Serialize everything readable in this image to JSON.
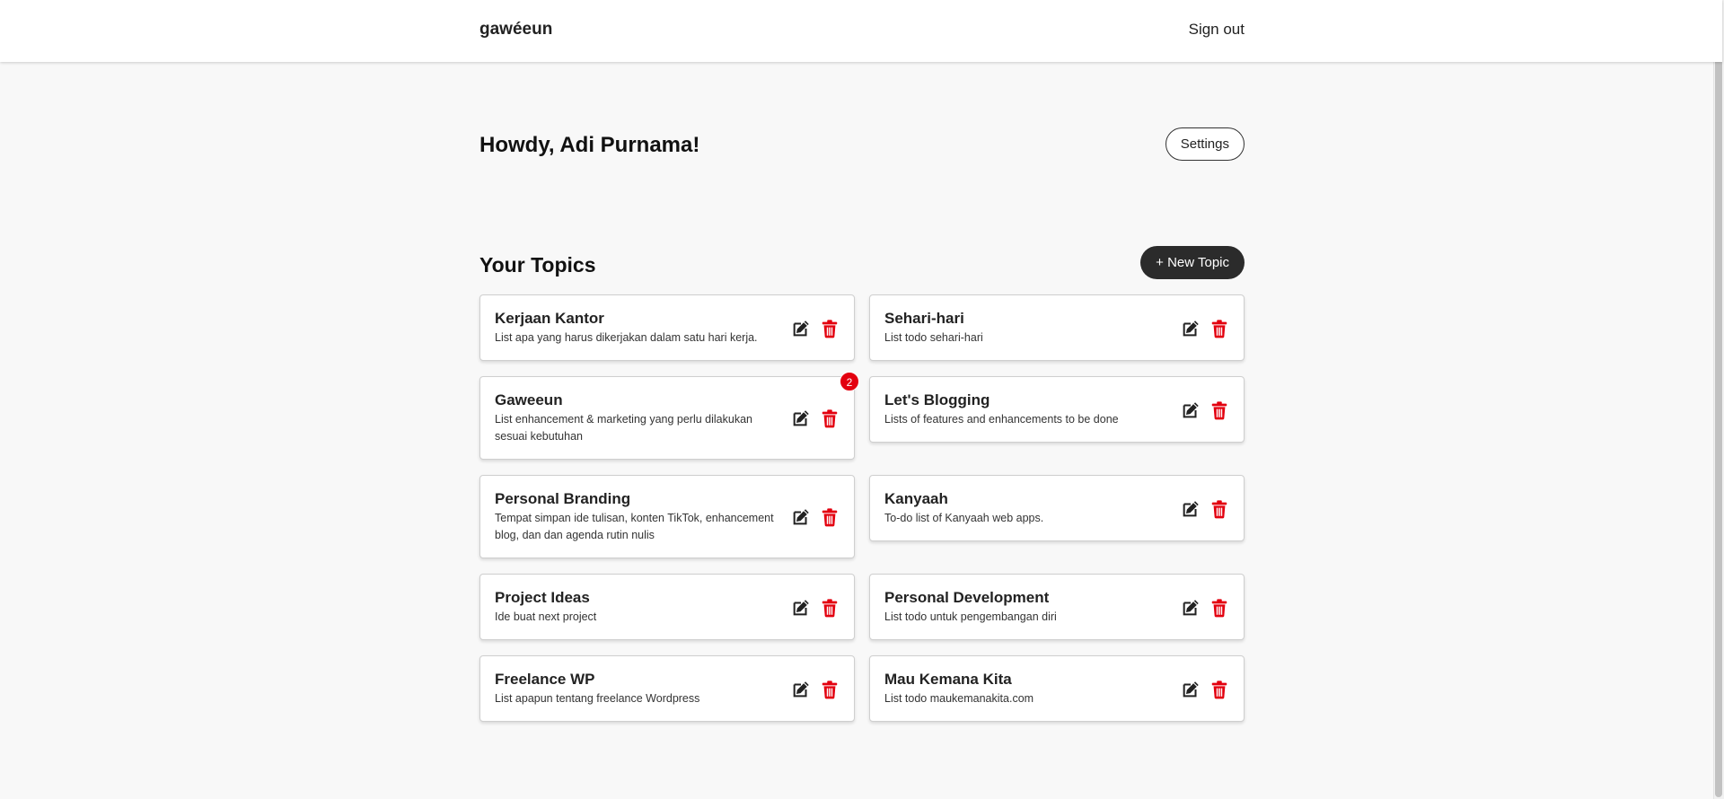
{
  "app": {
    "brand": "gawéeun",
    "sign_out_label": "Sign out"
  },
  "header": {
    "greeting": "Howdy, Adi Purnama!",
    "settings_label": "Settings"
  },
  "topics_section": {
    "title": "Your Topics",
    "new_topic_label": "+ New Topic"
  },
  "topics": [
    {
      "title": "Kerjaan Kantor",
      "description": "List apa yang harus dikerjakan dalam satu hari kerja.",
      "badge": ""
    },
    {
      "title": "Sehari-hari",
      "description": "List todo sehari-hari",
      "badge": ""
    },
    {
      "title": "Gaweeun",
      "description": "List enhancement & marketing yang perlu dilakukan sesuai kebutuhan",
      "badge": "2"
    },
    {
      "title": "Let's Blogging",
      "description": "Lists of features and enhancements to be done",
      "badge": ""
    },
    {
      "title": "Personal Branding",
      "description": "Tempat simpan ide tulisan, konten TikTok, enhancement blog, dan dan agenda rutin nulis",
      "badge": ""
    },
    {
      "title": "Kanyaah",
      "description": "To-do list of Kanyaah web apps.",
      "badge": ""
    },
    {
      "title": "Project Ideas",
      "description": "Ide buat next project",
      "badge": ""
    },
    {
      "title": "Personal Development",
      "description": "List todo untuk pengembangan diri",
      "badge": ""
    },
    {
      "title": "Freelance WP",
      "description": "List apapun tentang freelance Wordpress",
      "badge": ""
    },
    {
      "title": "Mau Kemana Kita",
      "description": "List todo maukemanakita.com",
      "badge": ""
    }
  ],
  "icons": {
    "edit": "edit-icon",
    "delete": "trash-icon"
  },
  "colors": {
    "delete": "#e3000f",
    "badge": "#e3000f",
    "primary_button": "#2b2b2b",
    "background": "#f8f8f8"
  }
}
